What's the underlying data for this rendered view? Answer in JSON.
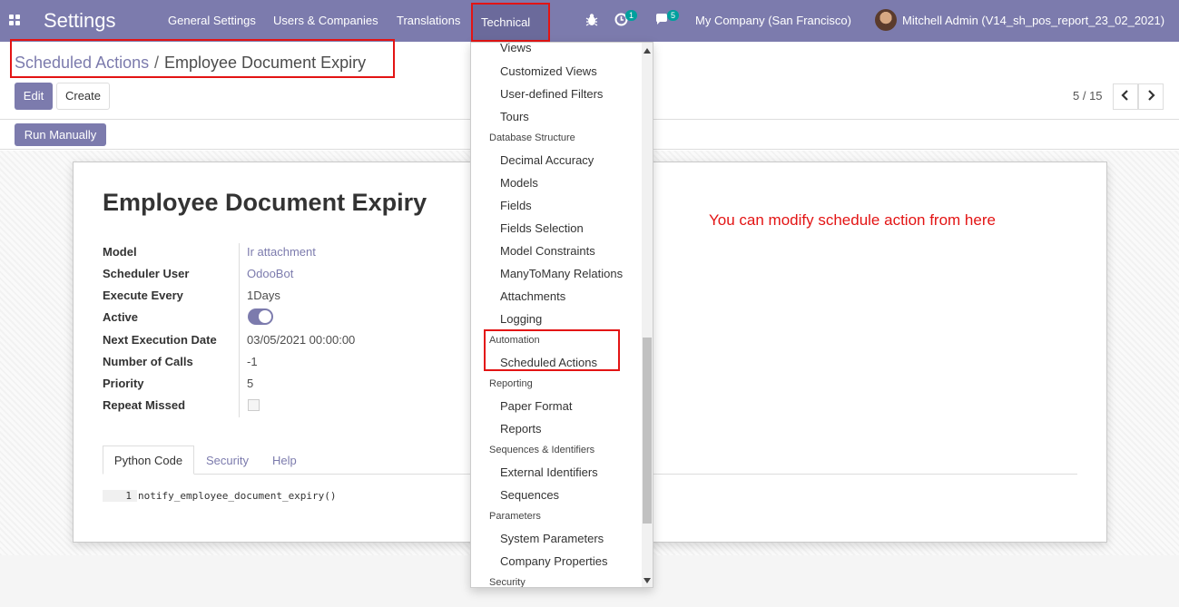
{
  "topbar": {
    "app_title": "Settings",
    "menu": [
      "General Settings",
      "Users & Companies",
      "Translations",
      "Technical"
    ],
    "activity_badge": "1",
    "messages_badge": "5",
    "company": "My Company (San Francisco)",
    "user": "Mitchell Admin (V14_sh_pos_report_23_02_2021)",
    "bug_icon": "bug-icon",
    "activity_icon": "clock-icon",
    "messages_icon": "chat-icon"
  },
  "breadcrumb": {
    "parent": "Scheduled Actions",
    "separator": "/",
    "current": "Employee Document Expiry"
  },
  "buttons": {
    "edit": "Edit",
    "create": "Create",
    "run_manually": "Run Manually"
  },
  "pager": {
    "text": "5 / 15",
    "prev": "‹",
    "next": "›"
  },
  "record": {
    "title": "Employee Document Expiry",
    "fields": [
      {
        "label": "Model",
        "value": "Ir attachment"
      },
      {
        "label": "Scheduler User",
        "value": "OdooBot"
      },
      {
        "label": "Execute Every",
        "value": "1Days"
      },
      {
        "label": "Active",
        "value": "true"
      },
      {
        "label": "Next Execution Date",
        "value": "03/05/2021 00:00:00"
      },
      {
        "label": "Number of Calls",
        "value": "-1"
      },
      {
        "label": "Priority",
        "value": "5"
      },
      {
        "label": "Repeat Missed",
        "value": "false"
      }
    ],
    "tabs": [
      "Python Code",
      "Security",
      "Help"
    ],
    "code": {
      "line_number": "1",
      "line": "notify_employee_document_expiry()"
    }
  },
  "annotation": "You can modify schedule action from here",
  "dropdown": {
    "items": [
      {
        "type": "item",
        "label": "Views"
      },
      {
        "type": "item",
        "label": "Customized Views"
      },
      {
        "type": "item",
        "label": "User-defined Filters"
      },
      {
        "type": "item",
        "label": "Tours"
      },
      {
        "type": "header",
        "label": "Database Structure"
      },
      {
        "type": "item",
        "label": "Decimal Accuracy"
      },
      {
        "type": "item",
        "label": "Models"
      },
      {
        "type": "item",
        "label": "Fields"
      },
      {
        "type": "item",
        "label": "Fields Selection"
      },
      {
        "type": "item",
        "label": "Model Constraints"
      },
      {
        "type": "item",
        "label": "ManyToMany Relations"
      },
      {
        "type": "item",
        "label": "Attachments"
      },
      {
        "type": "item",
        "label": "Logging"
      },
      {
        "type": "header",
        "label": "Automation"
      },
      {
        "type": "item",
        "label": "Scheduled Actions"
      },
      {
        "type": "header",
        "label": "Reporting"
      },
      {
        "type": "item",
        "label": "Paper Format"
      },
      {
        "type": "item",
        "label": "Reports"
      },
      {
        "type": "header",
        "label": "Sequences & Identifiers"
      },
      {
        "type": "item",
        "label": "External Identifiers"
      },
      {
        "type": "item",
        "label": "Sequences"
      },
      {
        "type": "header",
        "label": "Parameters"
      },
      {
        "type": "item",
        "label": "System Parameters"
      },
      {
        "type": "item",
        "label": "Company Properties"
      },
      {
        "type": "header",
        "label": "Security"
      }
    ]
  },
  "colors": {
    "brand": "#7c7bad",
    "highlight": "#e31414"
  }
}
